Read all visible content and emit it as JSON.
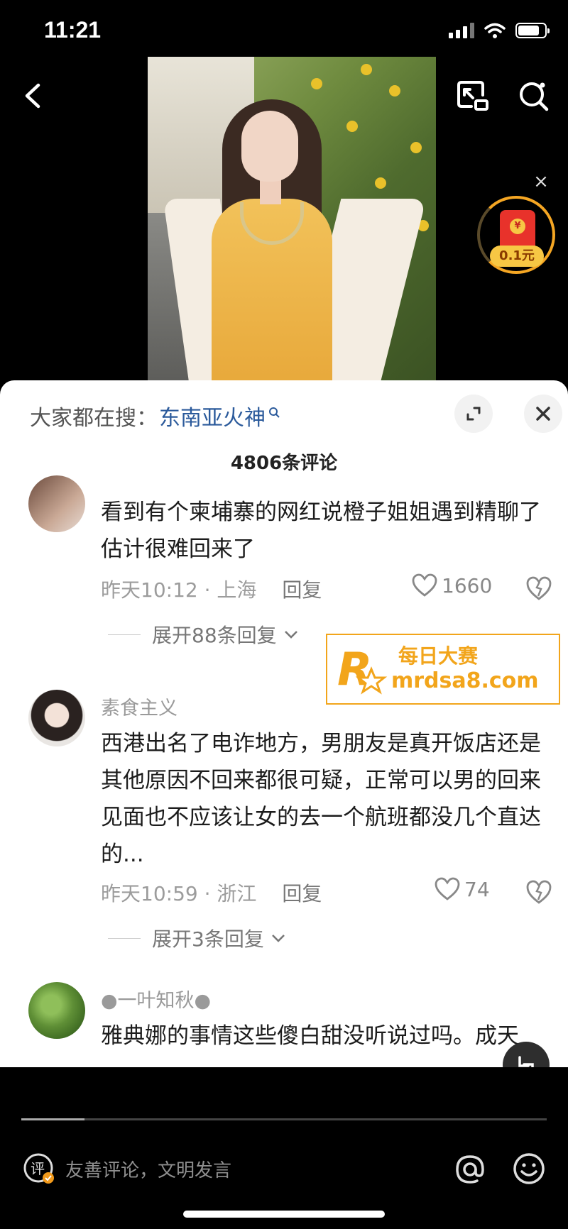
{
  "status_bar": {
    "time": "11:21"
  },
  "video": {
    "reward_label": "0.1元"
  },
  "sheet": {
    "hot_search_prefix": "大家都在搜：",
    "hot_search_keyword": "东南亚火神",
    "comments_count": "4806条评论"
  },
  "comments": [
    {
      "name": "",
      "text": "看到有个柬埔寨的网红说橙子姐姐遇到精聊了 估计很难回来了",
      "time": "昨天10:12 · 上海",
      "reply": "回复",
      "likes": "1660",
      "expand": "展开88条回复"
    },
    {
      "name": "素食主义",
      "text": "西港出名了电诈地方，男朋友是真开饭店还是其他原因不回来都很可疑，正常可以男的回来见面也不应该让女的去一个航班都没几个直达的...",
      "time": "昨天10:59 · 浙江",
      "reply": "回复",
      "likes": "74",
      "expand": "展开3条回复"
    },
    {
      "name": "●一叶知秋●",
      "text": "雅典娜的事情这些傻白甜没听说过吗。成天"
    }
  ],
  "watermark": {
    "cn": "每日大赛",
    "url": "mrdsa8.com",
    "logo_sub": "每日大赛"
  },
  "bottom": {
    "input_placeholder": "友善评论，文明发言",
    "progress": 0.12
  }
}
